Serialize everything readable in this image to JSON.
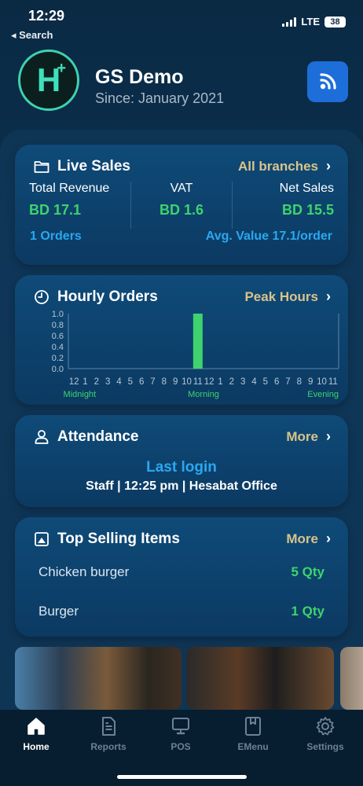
{
  "status": {
    "time": "12:29",
    "back": "◂ Search",
    "network": "LTE",
    "battery": "38"
  },
  "header": {
    "logo_letter": "H",
    "logo_plus": "+",
    "company": "GS Demo",
    "since": "Since: January 2021"
  },
  "live_sales": {
    "title": "Live Sales",
    "link": "All branches",
    "total_revenue_label": "Total Revenue",
    "total_revenue_value": "BD 17.1",
    "vat_label": "VAT",
    "vat_value": "BD 1.6",
    "net_sales_label": "Net Sales",
    "net_sales_value": "BD 15.5",
    "orders": "1 Orders",
    "avg_value": "Avg. Value 17.1/order"
  },
  "hourly_orders": {
    "title": "Hourly Orders",
    "link": "Peak Hours",
    "period_labels": [
      "Midnight",
      "Morning",
      "Evening"
    ]
  },
  "chart_data": {
    "type": "bar",
    "categories": [
      "12",
      "1",
      "2",
      "3",
      "4",
      "5",
      "6",
      "7",
      "8",
      "9",
      "10",
      "11",
      "12",
      "1",
      "2",
      "3",
      "4",
      "5",
      "6",
      "7",
      "8",
      "9",
      "10",
      "11"
    ],
    "values": [
      0,
      0,
      0,
      0,
      0,
      0,
      0,
      0,
      0,
      0,
      0,
      1.0,
      0,
      0,
      0,
      0,
      0,
      0,
      0,
      0,
      0,
      0,
      0,
      0
    ],
    "yticks": [
      "0.0",
      "0.2",
      "0.4",
      "0.6",
      "0.8",
      "1.0"
    ],
    "ylim": [
      0,
      1.0
    ],
    "color": "#3ed36e"
  },
  "attendance": {
    "title": "Attendance",
    "link": "More",
    "heading": "Last login",
    "detail": "Staff | 12:25 pm | Hesabat Office"
  },
  "top_selling": {
    "title": "Top Selling Items",
    "link": "More",
    "items": [
      {
        "name": "Chicken burger",
        "qty": "5 Qty"
      },
      {
        "name": "Burger",
        "qty": "1 Qty"
      }
    ]
  },
  "tabs": [
    {
      "label": "Home",
      "icon": "home-icon",
      "active": true
    },
    {
      "label": "Reports",
      "icon": "report-icon",
      "active": false
    },
    {
      "label": "POS",
      "icon": "pos-icon",
      "active": false
    },
    {
      "label": "EMenu",
      "icon": "emenu-icon",
      "active": false
    },
    {
      "label": "Settings",
      "icon": "gear-icon",
      "active": false
    }
  ],
  "colors": {
    "accent_green": "#3ed36e",
    "accent_blue": "#2aa8f0",
    "gold": "#d9c38a",
    "brand_teal": "#3fe0bd"
  }
}
